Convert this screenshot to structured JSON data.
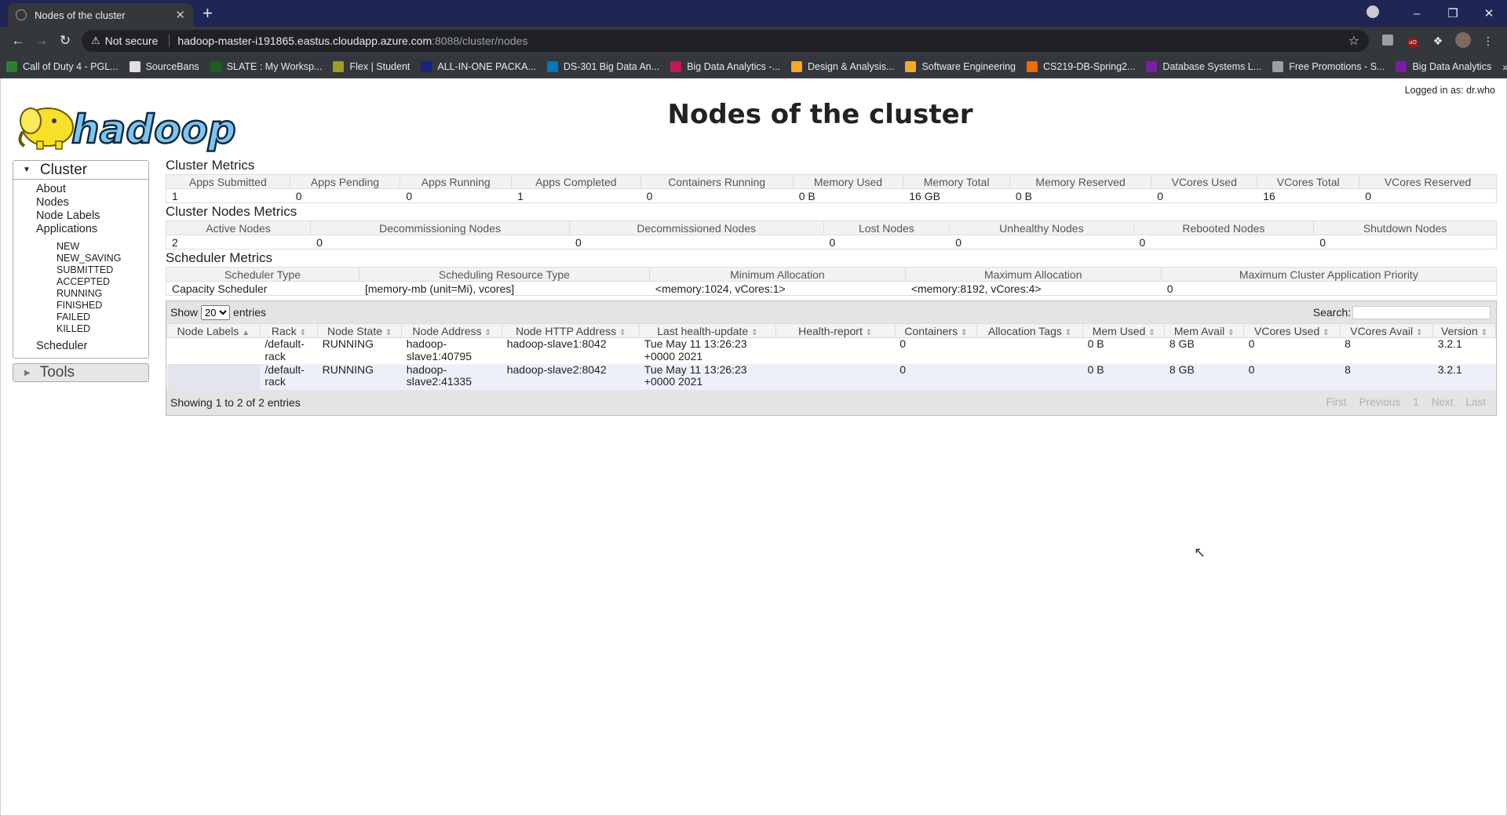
{
  "browser": {
    "tab_title": "Nodes of the cluster",
    "new_tab": "+",
    "security_text": "Not secure",
    "url_host": "hadoop-master-i191865.eastus.cloudapp.azure.com",
    "url_path": ":8088/cluster/nodes",
    "bookmarks": [
      {
        "label": "Call of Duty 4 - PGL...",
        "color": "#2e7d32"
      },
      {
        "label": "SourceBans",
        "color": "#e0e0e0"
      },
      {
        "label": "SLATE : My Worksp...",
        "color": "#1b5e20"
      },
      {
        "label": "Flex | Student",
        "color": "#9e9d24"
      },
      {
        "label": "ALL-IN-ONE PACKA...",
        "color": "#1a237e"
      },
      {
        "label": "DS-301 Big Data An...",
        "color": "#0277bd"
      },
      {
        "label": "Big Data Analytics -...",
        "color": "#c2185b"
      },
      {
        "label": "Design & Analysis...",
        "color": "#f9a825"
      },
      {
        "label": "Software Engineering",
        "color": "#f9a825"
      },
      {
        "label": "CS219-DB-Spring2...",
        "color": "#ef6c00"
      },
      {
        "label": "Database Systems L...",
        "color": "#7b1fa2"
      },
      {
        "label": "Free Promotions - S...",
        "color": "#9aa0a6"
      },
      {
        "label": "Big Data Analytics",
        "color": "#7b1fa2"
      }
    ]
  },
  "header": {
    "logged_in": "Logged in as: dr.who",
    "title": "Nodes of the cluster"
  },
  "sidebar": {
    "cluster_label": "Cluster",
    "links": [
      "About",
      "Nodes",
      "Node Labels",
      "Applications"
    ],
    "app_states": [
      "NEW",
      "NEW_SAVING",
      "SUBMITTED",
      "ACCEPTED",
      "RUNNING",
      "FINISHED",
      "FAILED",
      "KILLED"
    ],
    "scheduler_label": "Scheduler",
    "tools_label": "Tools"
  },
  "cluster_metrics": {
    "title": "Cluster Metrics",
    "headers": [
      "Apps Submitted",
      "Apps Pending",
      "Apps Running",
      "Apps Completed",
      "Containers Running",
      "Memory Used",
      "Memory Total",
      "Memory Reserved",
      "VCores Used",
      "VCores Total",
      "VCores Reserved"
    ],
    "values": [
      "1",
      "0",
      "0",
      "1",
      "0",
      "0 B",
      "16 GB",
      "0 B",
      "0",
      "16",
      "0"
    ]
  },
  "node_metrics": {
    "title": "Cluster Nodes Metrics",
    "headers": [
      "Active Nodes",
      "Decommissioning Nodes",
      "Decommissioned Nodes",
      "Lost Nodes",
      "Unhealthy Nodes",
      "Rebooted Nodes",
      "Shutdown Nodes"
    ],
    "values": [
      "2",
      "0",
      "0",
      "0",
      "0",
      "0",
      "0"
    ]
  },
  "scheduler_metrics": {
    "title": "Scheduler Metrics",
    "headers": [
      "Scheduler Type",
      "Scheduling Resource Type",
      "Minimum Allocation",
      "Maximum Allocation",
      "Maximum Cluster Application Priority"
    ],
    "values": [
      "Capacity Scheduler",
      "[memory-mb (unit=Mi), vcores]",
      "<memory:1024, vCores:1>",
      "<memory:8192, vCores:4>",
      "0"
    ]
  },
  "nodes_table": {
    "show_label": "Show",
    "page_size": "20",
    "entries_label": "entries",
    "search_label": "Search:",
    "headers": [
      "Node Labels",
      "Rack",
      "Node State",
      "Node Address",
      "Node HTTP Address",
      "Last health-update",
      "Health-report",
      "Containers",
      "Allocation Tags",
      "Mem Used",
      "Mem Avail",
      "VCores Used",
      "VCores Avail",
      "Version"
    ],
    "rows": [
      [
        "",
        "/default-rack",
        "RUNNING",
        "hadoop-slave1:40795",
        "hadoop-slave1:8042",
        "Tue May 11 13:26:23 +0000 2021",
        "",
        "0",
        "",
        "0 B",
        "8 GB",
        "0",
        "8",
        "3.2.1"
      ],
      [
        "",
        "/default-rack",
        "RUNNING",
        "hadoop-slave2:41335",
        "hadoop-slave2:8042",
        "Tue May 11 13:26:23 +0000 2021",
        "",
        "0",
        "",
        "0 B",
        "8 GB",
        "0",
        "8",
        "3.2.1"
      ]
    ],
    "showing": "Showing 1 to 2 of 2 entries",
    "pager": [
      "First",
      "Previous",
      "1",
      "Next",
      "Last"
    ]
  }
}
